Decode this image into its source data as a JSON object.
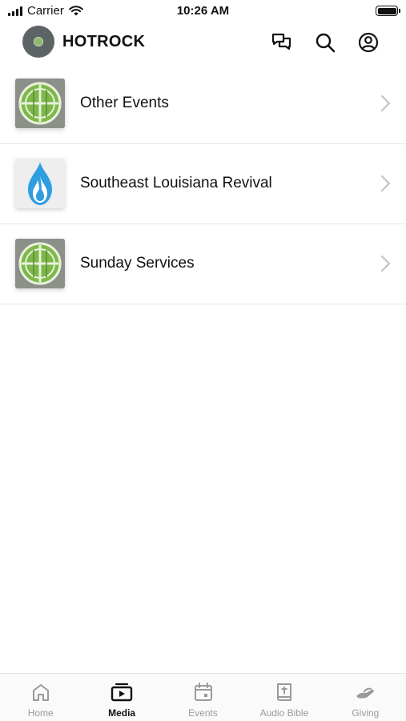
{
  "status_bar": {
    "carrier": "Carrier",
    "time": "10:26 AM"
  },
  "header": {
    "title": "HOTROCK",
    "icons": [
      "chat-icon",
      "search-icon",
      "profile-icon"
    ]
  },
  "media_list": {
    "items": [
      {
        "label": "Other Events",
        "thumbnail": "church-logo-icon"
      },
      {
        "label": "Southeast Louisiana Revival",
        "thumbnail": "flame-icon"
      },
      {
        "label": "Sunday Services",
        "thumbnail": "church-logo-icon"
      }
    ]
  },
  "tab_bar": {
    "tabs": [
      {
        "label": "Home",
        "icon": "home-icon",
        "active": false
      },
      {
        "label": "Media",
        "icon": "media-icon",
        "active": true
      },
      {
        "label": "Events",
        "icon": "calendar-icon",
        "active": false
      },
      {
        "label": "Audio Bible",
        "icon": "bible-icon",
        "active": false
      },
      {
        "label": "Giving",
        "icon": "giving-icon",
        "active": false
      }
    ]
  },
  "colors": {
    "accent_green": "#7db84a",
    "flame_blue": "#2f9ee0",
    "inactive_tab": "#9a9a9a"
  }
}
